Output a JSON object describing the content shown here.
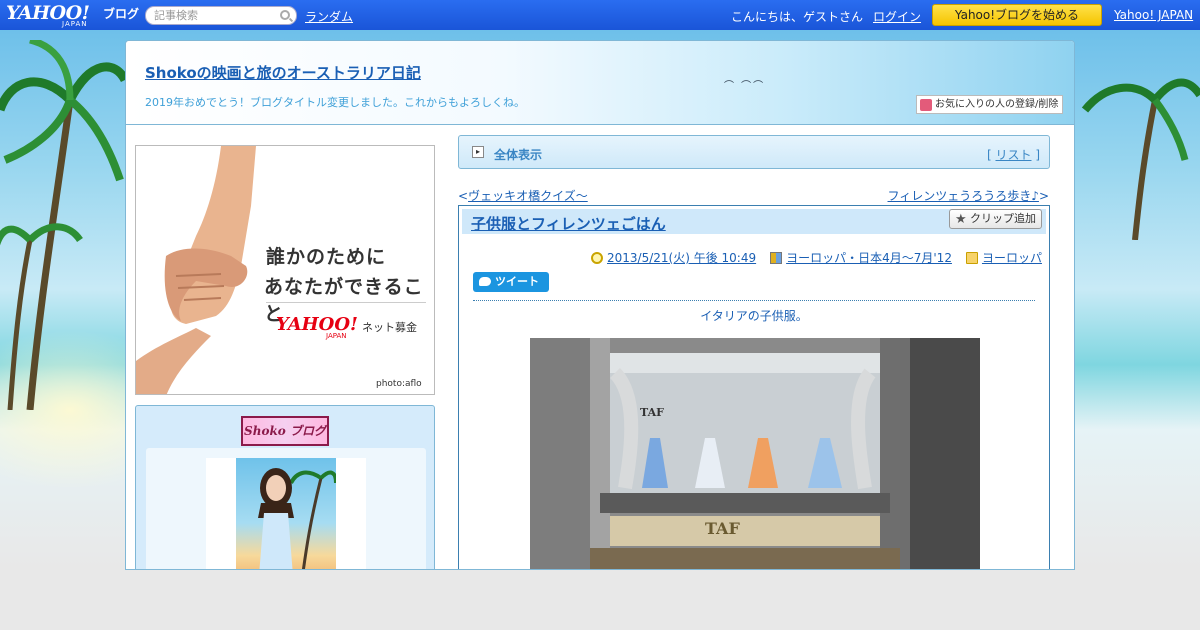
{
  "topbar": {
    "logo_text": "YAHOO!",
    "logo_sub": "JAPAN",
    "logo_blog": "ブログ",
    "search_placeholder": "記事検索",
    "random_label": "ランダム",
    "greeting": "こんにちは、ゲストさん",
    "login_label": "ログイン",
    "start_blog_label": "Yahoo!ブログを始める",
    "yahoo_japan_label": "Yahoo! JAPAN"
  },
  "header": {
    "blog_title": "Shokoの映画と旅のオーストラリア日記",
    "blog_subtitle": "2019年おめでとう！ブログタイトル変更しました。これからもよろしくね。",
    "favorite_label": "お気に入りの人の登録/削除"
  },
  "sidebar": {
    "ad": {
      "line1": "誰かのために",
      "line2": "あなたができること",
      "logo": "YAHOO!",
      "logo_sub": "JAPAN",
      "service": "ネット募金",
      "credit": "photo:aflo"
    },
    "profile_banner": "Shoko ブログ"
  },
  "nav": {
    "all_label": "全体表示",
    "list_open": "[ ",
    "list_label": "リスト",
    "list_close": " ]"
  },
  "pager": {
    "prev_prefix": "<",
    "prev_label": "ヴェッキオ橋クイズ～",
    "next_label": "フィレンツェうろうろ歩き♪",
    "next_suffix": ">"
  },
  "article": {
    "title": "子供服とフィレンツェごはん",
    "clip_label": "クリップ追加",
    "date": "2013/5/21(火) 午後 10:49",
    "theme": "ヨーロッパ・日本4月～7月'12",
    "category": "ヨーロッパ",
    "tweet_label": "ツイート",
    "caption": "イタリアの子供服。",
    "photo_sign1": "TAF",
    "photo_sign2": "TAF"
  }
}
